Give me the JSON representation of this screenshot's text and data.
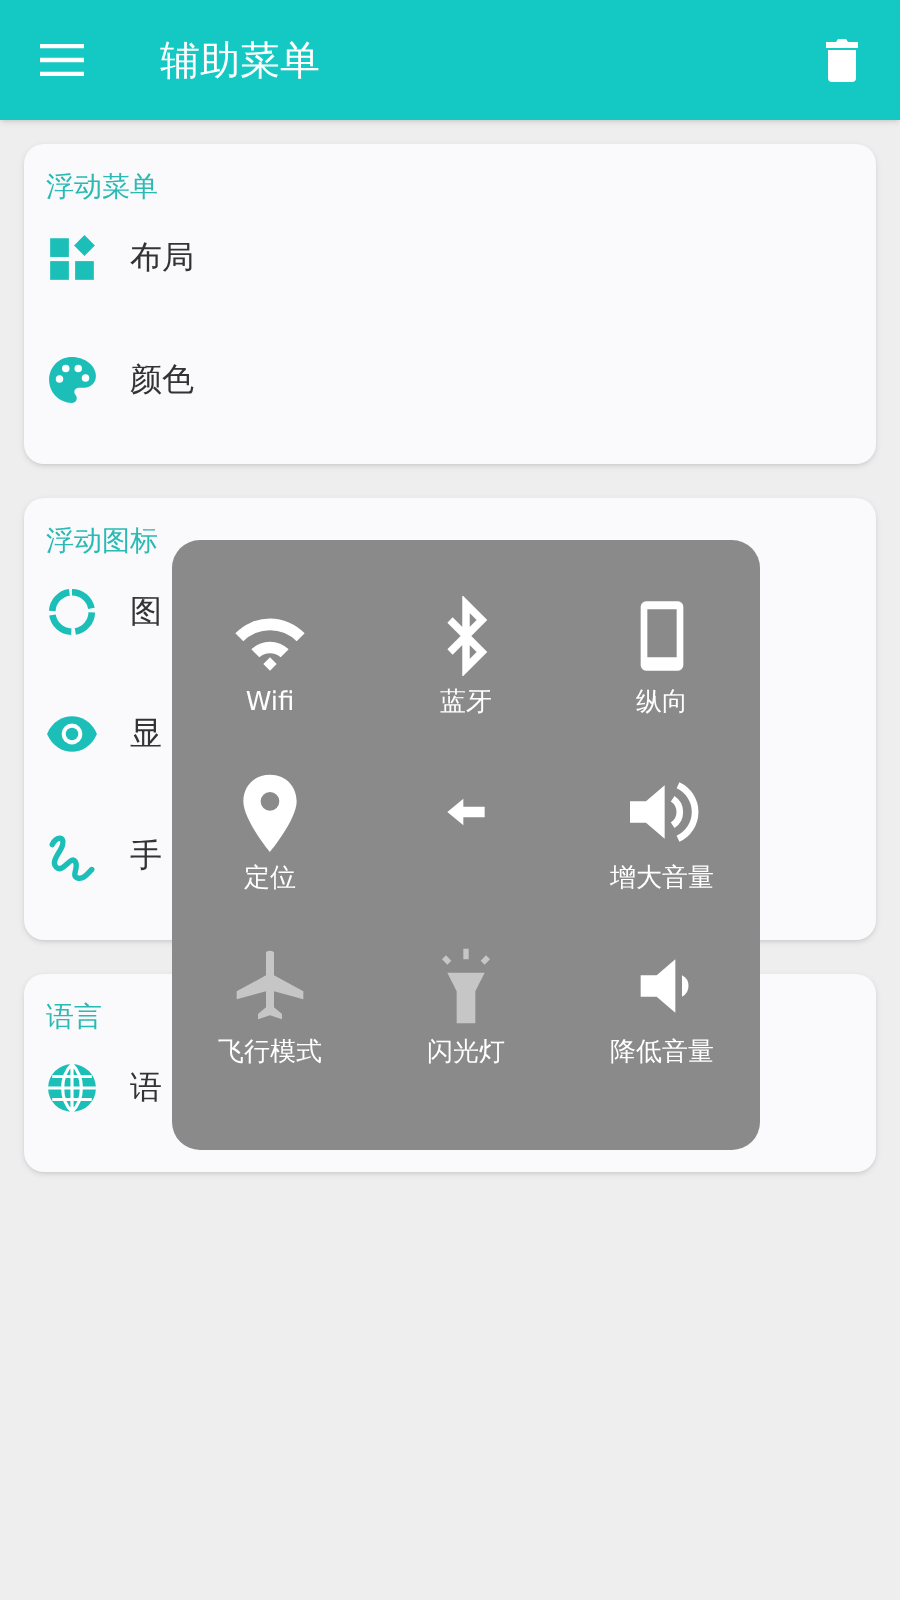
{
  "app_bar": {
    "title": "辅助菜单"
  },
  "sections": [
    {
      "title": "浮动菜单",
      "items": [
        {
          "kind": "layout",
          "label": "布局"
        },
        {
          "kind": "palette",
          "label": "颜色"
        }
      ]
    },
    {
      "title": "浮动图标",
      "items": [
        {
          "kind": "ring",
          "label": "图"
        },
        {
          "kind": "eye",
          "label": "显"
        },
        {
          "kind": "gesture",
          "label": "手"
        }
      ]
    },
    {
      "title": "语言",
      "items": [
        {
          "kind": "globe",
          "label": "语"
        }
      ]
    }
  ],
  "quick_menu": [
    {
      "kind": "wifi",
      "label": "Wifi",
      "on": true
    },
    {
      "kind": "bluetooth",
      "label": "蓝牙",
      "on": true
    },
    {
      "kind": "portrait",
      "label": "纵向",
      "on": true
    },
    {
      "kind": "location",
      "label": "定位",
      "on": true
    },
    {
      "kind": "back",
      "on": true
    },
    {
      "kind": "volume_up",
      "label": "增大音量",
      "on": true
    },
    {
      "kind": "airplane",
      "label": "飞行模式",
      "on": false
    },
    {
      "kind": "flashlight",
      "label": "闪光灯",
      "on": false
    },
    {
      "kind": "volume_down",
      "label": "降低音量",
      "on": true
    }
  ]
}
